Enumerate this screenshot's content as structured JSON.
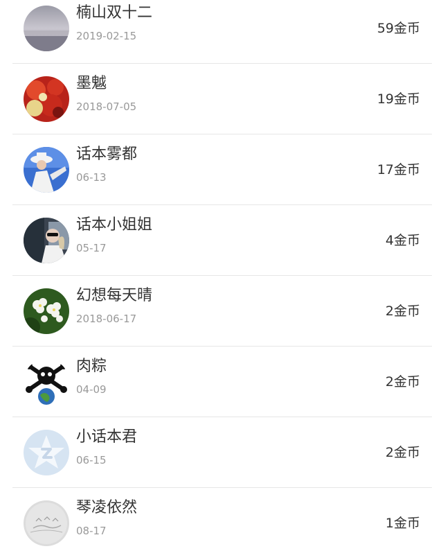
{
  "items": [
    {
      "name": "楠山双十二",
      "date": "2019-02-15",
      "coins": "59金币",
      "avatar": "landscape-avatar-icon"
    },
    {
      "name": "墨魆",
      "date": "2018-07-05",
      "coins": "19金币",
      "avatar": "red-flowers-avatar-icon"
    },
    {
      "name": "话本雾都",
      "date": "06-13",
      "coins": "17金币",
      "avatar": "person-white-hat-avatar-icon"
    },
    {
      "name": "话本小姐姐",
      "date": "05-17",
      "coins": "4金币",
      "avatar": "girl-sunglasses-avatar-icon"
    },
    {
      "name": "幻想每天晴",
      "date": "2018-06-17",
      "coins": "2金币",
      "avatar": "white-flowers-avatar-icon"
    },
    {
      "name": "肉粽",
      "date": "04-09",
      "coins": "2金币",
      "avatar": "skull-globe-avatar-icon"
    },
    {
      "name": "小话本君",
      "date": "06-15",
      "coins": "2金币",
      "avatar": "default-star-avatar-icon"
    },
    {
      "name": "琴凌依然",
      "date": "08-17",
      "coins": "1金币",
      "avatar": "gray-sketch-avatar-icon"
    }
  ],
  "colors": {
    "name_text": "#333333",
    "date_text": "#999999",
    "divider": "#e6e6e6",
    "default_avatar_bg": "#d6e4f2"
  }
}
